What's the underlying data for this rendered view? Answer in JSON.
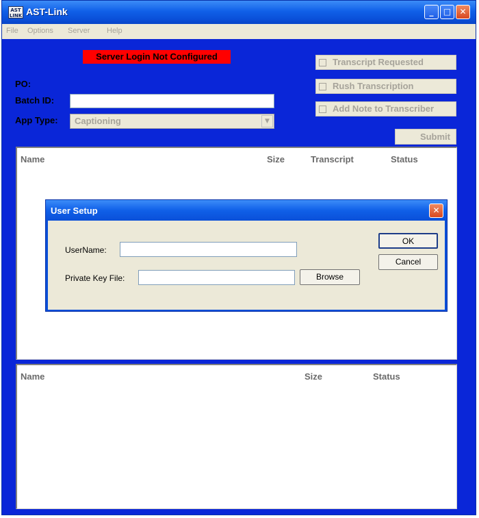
{
  "window": {
    "icon_text": "AST LINK",
    "title": "AST-Link",
    "controls": {
      "minimize": "_",
      "maximize": "□",
      "close": "✕"
    }
  },
  "menu": [
    "File",
    "Options",
    "Server",
    "Help"
  ],
  "form": {
    "status_message": "Server Login Not Configured",
    "po_label": "PO:",
    "batch_id_label": "Batch ID:",
    "batch_id_value": "",
    "app_type_label": "App Type:",
    "app_type_value": "Captioning",
    "checkboxes": [
      {
        "label": "Transcript Requested",
        "checked": false
      },
      {
        "label": "Rush Transcription",
        "checked": false
      },
      {
        "label": "Add Note to Transcriber",
        "checked": false
      }
    ],
    "submit_label": "Submit"
  },
  "upload_list": {
    "columns": [
      "Name",
      "Size",
      "Transcript",
      "Status"
    ]
  },
  "download_list": {
    "columns": [
      "Name",
      "Size",
      "Status"
    ]
  },
  "dialog": {
    "title": "User Setup",
    "username_label": "UserName:",
    "username_value": "",
    "private_key_label": "Private Key File:",
    "private_key_value": "",
    "browse_label": "Browse",
    "ok_label": "OK",
    "cancel_label": "Cancel"
  },
  "colors": {
    "window_blue": "#0a26d8",
    "warning_red": "#ff0000",
    "disabled_text": "#a6a39a",
    "xp_face": "#ece9d8"
  },
  "icons": {
    "app": "ast-link-logo-icon",
    "dropdown": "chevron-down-icon",
    "close": "close-icon"
  }
}
